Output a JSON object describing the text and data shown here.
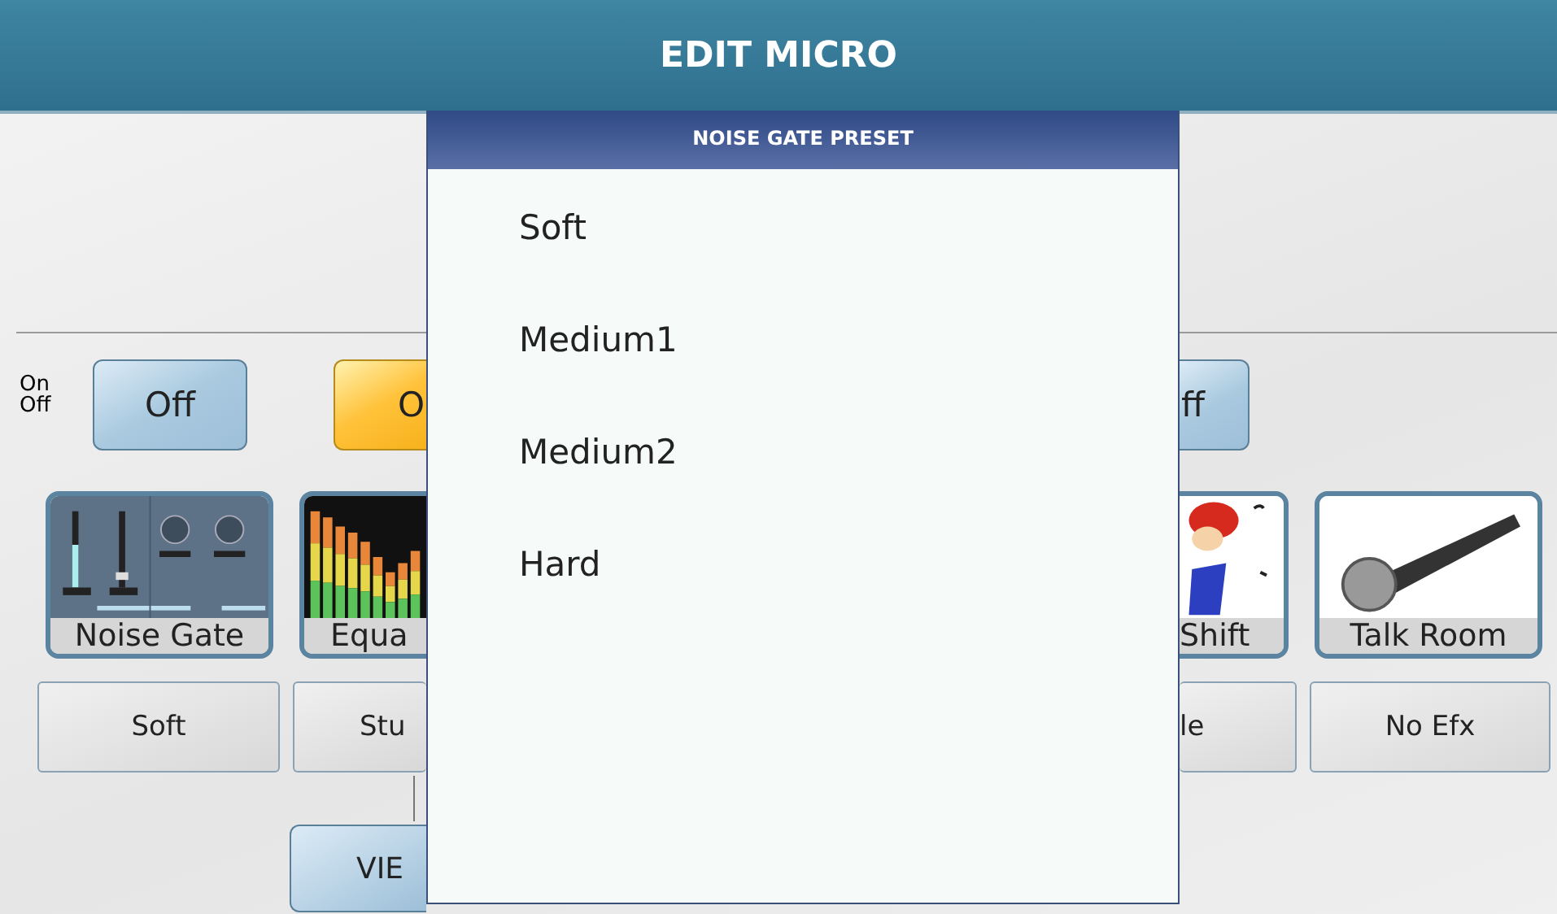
{
  "header": {
    "title": "EDIT MICRO"
  },
  "on_off_label": {
    "line_1": "On",
    "line_2": "Off"
  },
  "switches": [
    {
      "label": "Off",
      "on": false
    },
    {
      "label": "O",
      "on": true
    },
    {
      "label": "ff",
      "on": false
    }
  ],
  "effects": [
    {
      "label": "Noise Gate",
      "kind": "noise-gate"
    },
    {
      "label": "Equa",
      "kind": "equalizer"
    },
    {
      "label": "Shift",
      "kind": "cartoon"
    },
    {
      "label": "Talk Room",
      "kind": "microphone"
    }
  ],
  "presets": [
    "Soft",
    "Stu",
    "le",
    "No Efx"
  ],
  "view_button": "VIE",
  "popup": {
    "title": "NOISE GATE PRESET",
    "options": [
      {
        "label": "Soft"
      },
      {
        "label": "Medium1"
      },
      {
        "label": "Medium2"
      },
      {
        "label": "Hard"
      }
    ]
  }
}
